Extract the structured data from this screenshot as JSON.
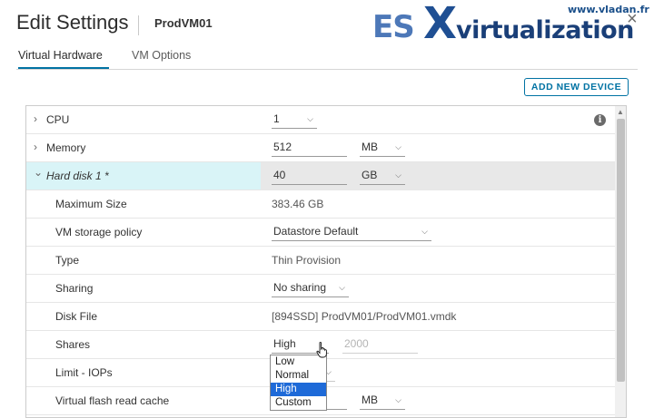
{
  "dialog": {
    "title": "Edit Settings",
    "vm_name": "ProdVM01",
    "close_glyph": "×"
  },
  "watermark": {
    "url": "www.vladan.fr",
    "es": "ES",
    "x": "X",
    "virt": "virtualization"
  },
  "tabs": [
    {
      "label": "Virtual Hardware",
      "active": true
    },
    {
      "label": "VM Options",
      "active": false
    }
  ],
  "toolbar": {
    "add_device_label": "ADD NEW DEVICE"
  },
  "hardware": {
    "cpu": {
      "label": "CPU",
      "value": "1"
    },
    "memory": {
      "label": "Memory",
      "value": "512",
      "unit": "MB"
    },
    "hard_disk": {
      "label": "Hard disk 1 *",
      "value": "40",
      "unit": "GB"
    },
    "max_size": {
      "label": "Maximum Size",
      "value": "383.46 GB"
    },
    "storage_policy": {
      "label": "VM storage policy",
      "value": "Datastore Default"
    },
    "type": {
      "label": "Type",
      "value": "Thin Provision"
    },
    "sharing": {
      "label": "Sharing",
      "value": "No sharing"
    },
    "disk_file": {
      "label": "Disk File",
      "value": "[894SSD] ProdVM01/ProdVM01.vmdk"
    },
    "shares": {
      "label": "Shares",
      "value": "High",
      "number": "2000"
    },
    "limit_iops": {
      "label": "Limit - IOPs"
    },
    "flash_cache": {
      "label": "Virtual flash read cache",
      "unit": "MB"
    }
  },
  "shares_dropdown": {
    "options": [
      "Low",
      "Normal",
      "High",
      "Custom"
    ],
    "selected": "High"
  },
  "icons": {
    "info": "i",
    "chevron_right": "›",
    "chevron_down": "⌄",
    "dropdown": "⌵",
    "scroll_up": "▲"
  },
  "colors": {
    "accent": "#0072a3",
    "highlight_row": "#d9f4f7",
    "selected_option": "#1e6ad8"
  }
}
